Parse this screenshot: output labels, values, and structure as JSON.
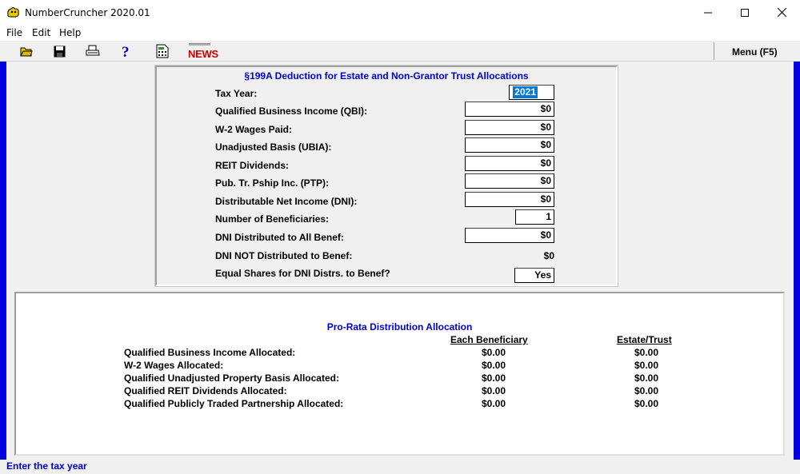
{
  "window": {
    "title": "NumberCruncher 2020.01"
  },
  "menubar": {
    "items": [
      "File",
      "Edit",
      "Help"
    ]
  },
  "toolbar": {
    "icons": [
      "open-folder-icon",
      "save-disk-icon",
      "printer-icon",
      "help-question-icon",
      "calculator-icon"
    ],
    "news_label": "NEWS",
    "menu_label": "Menu (F5)"
  },
  "form": {
    "title": "§199A Deduction for Estate and Non-Grantor Trust  Allocations",
    "fields": [
      {
        "label": "Tax Year:",
        "value": "2021"
      },
      {
        "label": "Qualified Business Income (QBI):",
        "value": "$0"
      },
      {
        "label": "W-2 Wages Paid:",
        "value": "$0"
      },
      {
        "label": "Unadjusted Basis (UBIA):",
        "value": "$0"
      },
      {
        "label": "REIT Dividends:",
        "value": "$0"
      },
      {
        "label": "Pub. Tr. Pship Inc. (PTP):",
        "value": "$0"
      },
      {
        "label": "Distributable Net Income (DNI):",
        "value": "$0"
      },
      {
        "label": "Number of Beneficiaries:",
        "value": "1"
      },
      {
        "label": "DNI Distributed to All Benef:",
        "value": "$0"
      },
      {
        "label": "DNI NOT Distributed to Benef:",
        "value": "$0"
      },
      {
        "label": "Equal Shares for DNI Distrs. to Benef?",
        "value": "Yes"
      }
    ]
  },
  "allocation": {
    "title": "Pro-Rata Distribution Allocation",
    "col_each": "Each Beneficiary",
    "col_estate": "Estate/Trust",
    "rows": [
      {
        "label": "Qualified Business Income Allocated:",
        "each": "$0.00",
        "estate": "$0.00"
      },
      {
        "label": "W-2 Wages Allocated:",
        "each": "$0.00",
        "estate": "$0.00"
      },
      {
        "label": "Qualified Unadjusted Property Basis Allocated:",
        "each": "$0.00",
        "estate": "$0.00"
      },
      {
        "label": "Qualified REIT Dividends Allocated:",
        "each": "$0.00",
        "estate": "$0.00"
      },
      {
        "label": "Qualified Publicly Traded Partnership Allocated:",
        "each": "$0.00",
        "estate": "$0.00"
      }
    ]
  },
  "status": {
    "text": "Enter the tax year"
  },
  "colors": {
    "accent_blue": "#0000cc",
    "edge_blue": "#0000e0",
    "news_red": "#cc0000",
    "selection": "#0078d7"
  }
}
